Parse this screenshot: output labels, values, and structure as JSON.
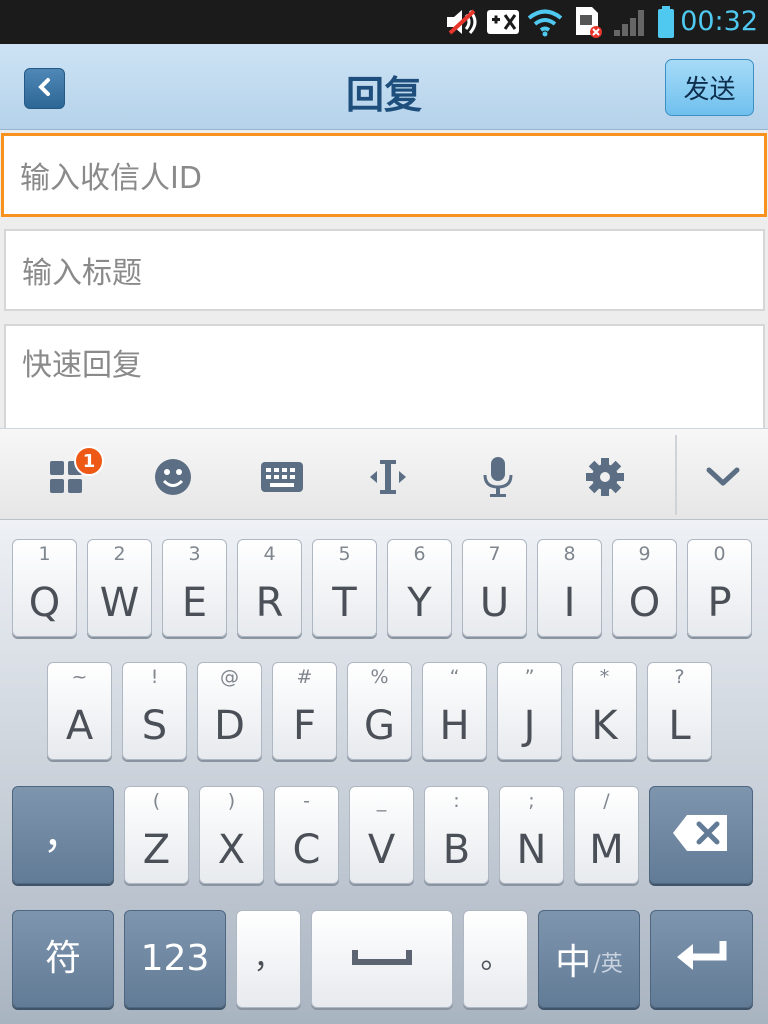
{
  "status_bar": {
    "time": "00:32",
    "icons": [
      "mute-icon",
      "gamepad-icon",
      "wifi-icon",
      "sim-error-icon",
      "signal-icon",
      "battery-icon"
    ]
  },
  "header": {
    "title": "回复",
    "send_label": "发送"
  },
  "form": {
    "recipient_placeholder": "输入收信人ID",
    "subject_placeholder": "输入标题",
    "body_placeholder": "快速回复"
  },
  "toolbar": {
    "badge_count": "1",
    "icons": [
      "apps-grid-icon",
      "emoji-icon",
      "keyboard-icon",
      "cursor-icon",
      "microphone-icon",
      "settings-icon",
      "collapse-icon"
    ]
  },
  "keyboard": {
    "row1": [
      {
        "hint": "1",
        "label": "Q"
      },
      {
        "hint": "2",
        "label": "W"
      },
      {
        "hint": "3",
        "label": "E"
      },
      {
        "hint": "4",
        "label": "R"
      },
      {
        "hint": "5",
        "label": "T"
      },
      {
        "hint": "6",
        "label": "Y"
      },
      {
        "hint": "7",
        "label": "U"
      },
      {
        "hint": "8",
        "label": "I"
      },
      {
        "hint": "9",
        "label": "O"
      },
      {
        "hint": "0",
        "label": "P"
      }
    ],
    "row2": [
      {
        "hint": "~",
        "label": "A"
      },
      {
        "hint": "!",
        "label": "S"
      },
      {
        "hint": "@",
        "label": "D"
      },
      {
        "hint": "#",
        "label": "F"
      },
      {
        "hint": "%",
        "label": "G"
      },
      {
        "hint": "“",
        "label": "H"
      },
      {
        "hint": "”",
        "label": "J"
      },
      {
        "hint": "*",
        "label": "K"
      },
      {
        "hint": "?",
        "label": "L"
      }
    ],
    "row3": [
      {
        "hint": "(",
        "label": "Z"
      },
      {
        "hint": ")",
        "label": "X"
      },
      {
        "hint": "-",
        "label": "C"
      },
      {
        "hint": "_",
        "label": "V"
      },
      {
        "hint": ":",
        "label": "B"
      },
      {
        "hint": ";",
        "label": "N"
      },
      {
        "hint": "/",
        "label": "M"
      }
    ],
    "comma_key": "，",
    "symbols_key": "符",
    "numbers_key": "123",
    "comma_small": "，",
    "period_key": "。",
    "lang_main": "中",
    "lang_alt": "/英"
  },
  "colors": {
    "accent_orange": "#f7921e",
    "header_blue": "#b5d2ea",
    "status_time": "#4fc9ef"
  }
}
